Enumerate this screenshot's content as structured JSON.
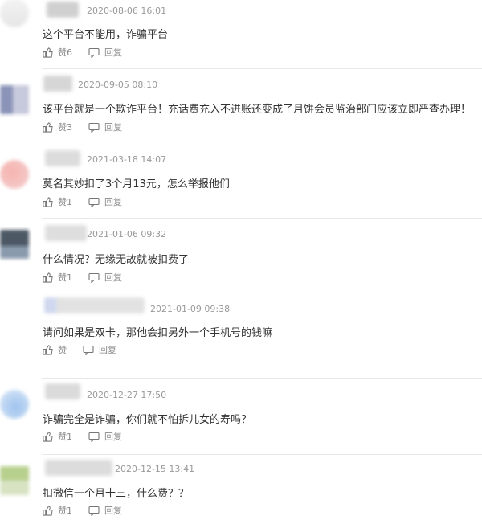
{
  "comments": [
    {
      "time": "2020-08-06 16:01",
      "text": "这个平台不能用，诈骗平台",
      "like_label": "赞6",
      "reply_label": "回复"
    },
    {
      "time": "2020-09-05 08:10",
      "text": "该平台就是一个欺诈平台！充话费充入不进账还变成了月饼会员监治部门应该立即严查办理！",
      "like_label": "赞3",
      "reply_label": "回复"
    },
    {
      "time": "2021-03-18 14:07",
      "text": "莫名其妙扣了3个月13元，怎么举报他们",
      "like_label": "赞1",
      "reply_label": "回复"
    },
    {
      "time": "2021-01-06 09:32",
      "text": "什么情况？无缘无故就被扣费了",
      "like_label": "赞1",
      "reply_label": "回复"
    },
    {
      "time": "2021-01-09 09:38",
      "text": "请问如果是双卡，那他会扣另外一个手机号的钱嘛",
      "like_label": "赞",
      "reply_label": "回复"
    },
    {
      "time": "2020-12-27 17:50",
      "text": "诈骗完全是诈骗，你们就不怕拆儿女的寿吗？",
      "like_label": "赞1",
      "reply_label": "回复"
    },
    {
      "time": "2020-12-15 13:41",
      "text": "扣微信一个月十三，什么费？？",
      "like_label": "赞1",
      "reply_label": "回复"
    }
  ],
  "colors": {
    "text": "#333333",
    "meta": "#999999",
    "divider": "#e8e8e8"
  },
  "icons": {
    "like": "thumbs-up-icon",
    "reply": "reply-icon"
  }
}
